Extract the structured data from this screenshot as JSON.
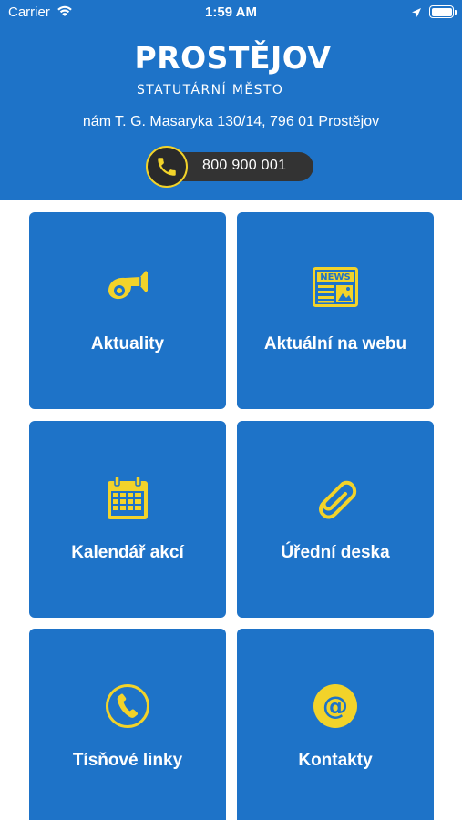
{
  "status_bar": {
    "carrier": "Carrier",
    "time": "1:59 AM"
  },
  "header": {
    "title": "PROSTĚJOV",
    "subtitle": "STATUTÁRNÍ MĚSTO",
    "address": "nám T. G. Masaryka 130/14, 796 01 Prostějov",
    "phone": "800 900 001"
  },
  "colors": {
    "primary_blue": "#1e73c8",
    "accent_yellow": "#f2d32a",
    "pill_dark": "#333333"
  },
  "tiles": [
    {
      "label": "Aktuality",
      "icon": "post-horn-icon"
    },
    {
      "label": "Aktuální na webu",
      "icon": "newspaper-icon"
    },
    {
      "label": "Kalendář akcí",
      "icon": "calendar-icon"
    },
    {
      "label": "Úřední deska",
      "icon": "paperclip-icon"
    },
    {
      "label": "Tísňové linky",
      "icon": "emergency-phone-icon"
    },
    {
      "label": "Kontakty",
      "icon": "at-sign-icon"
    }
  ]
}
